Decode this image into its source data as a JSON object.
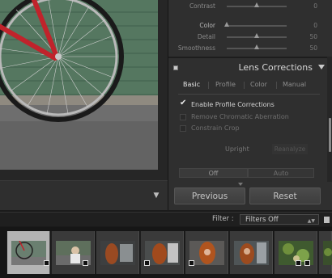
{
  "colors": {
    "panel_bg": "#2f2f2f",
    "app_bg": "#1a1a1a",
    "selected_thumb": "#b4b4b4",
    "bike_frame": "#c0232b"
  },
  "basic_sliders": [
    {
      "label": "Contrast",
      "value": "0",
      "level": 0.5
    },
    {
      "label": "Color",
      "value": "0",
      "level": 0.0
    },
    {
      "label": "Detail",
      "value": "50",
      "level": 0.5
    },
    {
      "label": "Smoothness",
      "value": "50",
      "level": 0.5
    }
  ],
  "lens_panel": {
    "title": "Lens Corrections",
    "collapse_icon": "triangle-down-icon",
    "tabs": [
      "Basic",
      "Profile",
      "Color",
      "Manual"
    ],
    "active_tab": "Basic",
    "checks": [
      {
        "label": "Enable Profile Corrections",
        "checked": true
      },
      {
        "label": "Remove Chromatic Aberration",
        "checked": false
      },
      {
        "label": "Constrain Crop",
        "checked": false
      }
    ],
    "upright_label": "Upright",
    "reanalyze_label": "Reanalyze",
    "upright_modes": [
      "Off",
      "Auto"
    ]
  },
  "buttons": {
    "previous": "Previous",
    "reset": "Reset"
  },
  "filmstrip": {
    "filter_label": "Filter :",
    "filter_value": "Filters Off",
    "thumb_count": 8,
    "selected_index": 0
  }
}
